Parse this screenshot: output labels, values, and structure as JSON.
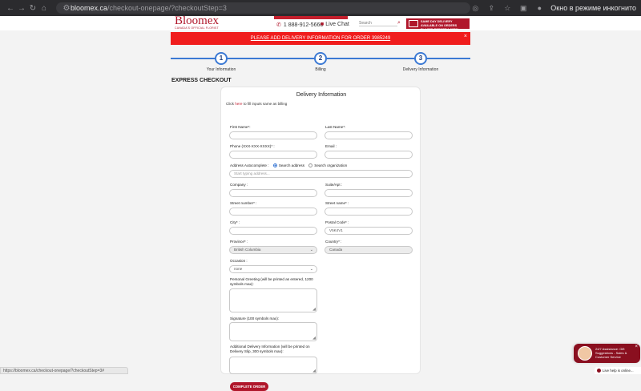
{
  "browser": {
    "url_host": "bloomex.ca",
    "url_path": "/checkout-onepage/?checkoutStep=3",
    "incognito_label": "Окно в режиме инкогнито",
    "status_url": "https://bloomex.ca/checkout-onepage/?checkoutStep=3#"
  },
  "header": {
    "logo": "Bloomex",
    "tagline": "CANADA'S OFFICIAL FLORIST",
    "phone": "1 888-912-5666",
    "live_chat": "Live Chat",
    "search_placeholder": "Search",
    "same_day_banner": "SAME DAY DELIVERY AVAILABLE ON ORDERS PLACED BEFORE 1:00PM"
  },
  "alert": {
    "text": "PLEASE ADD DELIVERY INFORMATION FOR ORDER 3985249",
    "close": "×"
  },
  "steps": [
    {
      "number": "1",
      "label": "Your Information"
    },
    {
      "number": "2",
      "label": "Billing"
    },
    {
      "number": "3",
      "label": "Delivery Information"
    }
  ],
  "section_title": "EXPRESS CHECKOUT",
  "form": {
    "title": "Delivery Information",
    "fill_hint_prefix": "Click",
    "fill_hint_link": "here",
    "fill_hint_suffix": "to fill inputs same as billing",
    "first_name_label": "First Name*:",
    "last_name_label": "Last Name*:",
    "phone_label": "Phone (XXX-XXX-XXXX)* :",
    "email_label": "Email :",
    "address_auto_label": "Address Autocomplete :",
    "radio_search_address": "Search address",
    "radio_search_org": "Search organization",
    "address_placeholder": "Start typing address...",
    "company_label": "Company :",
    "suite_label": "Suite/Apt :",
    "street_number_label": "Street number* :",
    "street_name_label": "Street name* :",
    "city_label": "City* :",
    "postal_label": "Postal Code* :",
    "postal_value": "V5K4V1",
    "province_label": "Province* :",
    "province_value": "British Columbia",
    "country_label": "Country* :",
    "country_value": "Canada",
    "occasion_label": "Occasion :",
    "occasion_value": "none",
    "greeting_label": "Personal Greeting (will be printed as entered, 1200 symbols max):",
    "signature_label": "Signature (100 symbols max):",
    "delivery_info_label": "Additional Delivery Information (will be printed on Delivery Slip, 300 symbols max):",
    "complete_button": "COMPLETE ORDER"
  },
  "chat_widget": {
    "message": "24/7 Assistance: Gift Suggestions - Sales & Customer Service",
    "close": "×",
    "bar_label": "Live help is online..."
  }
}
